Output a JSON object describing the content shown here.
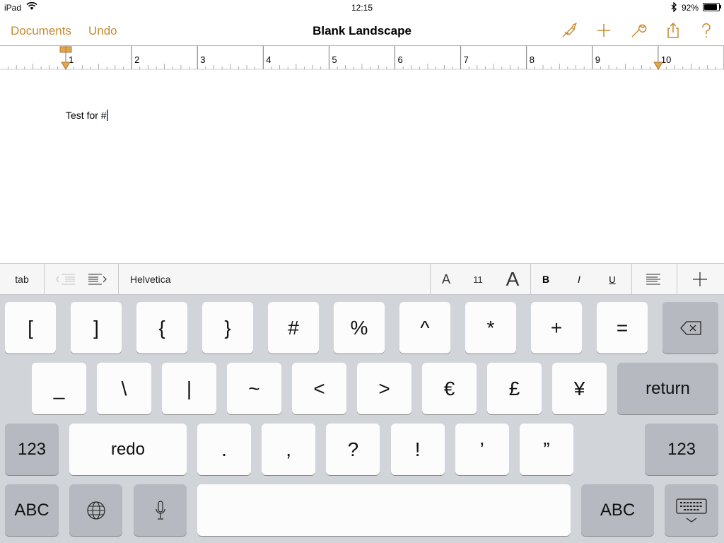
{
  "status_bar": {
    "carrier": "iPad",
    "time": "12:15",
    "battery_percent": "92%",
    "battery_level": 0.92
  },
  "nav": {
    "documents_label": "Documents",
    "undo_label": "Undo",
    "title": "Blank Landscape",
    "icons": [
      "paintbrush-icon",
      "plus-icon",
      "wrench-icon",
      "share-icon",
      "help-icon"
    ],
    "accent_color": "#c9892d"
  },
  "ruler": {
    "labels": [
      "1",
      "2",
      "3",
      "4",
      "5",
      "6",
      "7",
      "8",
      "9",
      "10"
    ]
  },
  "document": {
    "text": "Test for #"
  },
  "format_bar": {
    "tab_label": "tab",
    "font_name": "Helvetica",
    "decrease_font_label": "A",
    "font_size": "11",
    "increase_font_label": "A",
    "bold_label": "B",
    "italic_label": "I",
    "underline_label": "U"
  },
  "keyboard": {
    "row1": [
      "[",
      "]",
      "{",
      "}",
      "#",
      "%",
      "^",
      "*",
      "+",
      "="
    ],
    "row2": [
      "_",
      "\\",
      "|",
      "~",
      "<",
      ">",
      "€",
      "£",
      "¥"
    ],
    "return_label": "return",
    "row3_left": "123",
    "redo_label": "redo",
    "row3": [
      ".",
      ",",
      "?",
      "!",
      "’",
      "”"
    ],
    "row3_right": "123",
    "abc_left": "ABC",
    "abc_right": "ABC"
  }
}
